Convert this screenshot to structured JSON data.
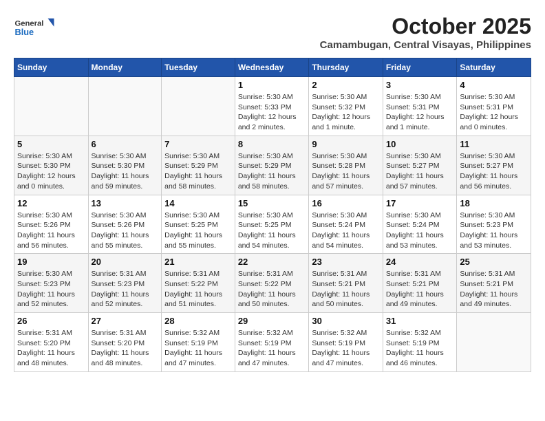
{
  "header": {
    "logo_line1": "General",
    "logo_line2": "Blue",
    "month_year": "October 2025",
    "location": "Camambugan, Central Visayas, Philippines"
  },
  "weekdays": [
    "Sunday",
    "Monday",
    "Tuesday",
    "Wednesday",
    "Thursday",
    "Friday",
    "Saturday"
  ],
  "weeks": [
    [
      {
        "day": "",
        "info": ""
      },
      {
        "day": "",
        "info": ""
      },
      {
        "day": "",
        "info": ""
      },
      {
        "day": "1",
        "info": "Sunrise: 5:30 AM\nSunset: 5:33 PM\nDaylight: 12 hours\nand 2 minutes."
      },
      {
        "day": "2",
        "info": "Sunrise: 5:30 AM\nSunset: 5:32 PM\nDaylight: 12 hours\nand 1 minute."
      },
      {
        "day": "3",
        "info": "Sunrise: 5:30 AM\nSunset: 5:31 PM\nDaylight: 12 hours\nand 1 minute."
      },
      {
        "day": "4",
        "info": "Sunrise: 5:30 AM\nSunset: 5:31 PM\nDaylight: 12 hours\nand 0 minutes."
      }
    ],
    [
      {
        "day": "5",
        "info": "Sunrise: 5:30 AM\nSunset: 5:30 PM\nDaylight: 12 hours\nand 0 minutes."
      },
      {
        "day": "6",
        "info": "Sunrise: 5:30 AM\nSunset: 5:30 PM\nDaylight: 11 hours\nand 59 minutes."
      },
      {
        "day": "7",
        "info": "Sunrise: 5:30 AM\nSunset: 5:29 PM\nDaylight: 11 hours\nand 58 minutes."
      },
      {
        "day": "8",
        "info": "Sunrise: 5:30 AM\nSunset: 5:29 PM\nDaylight: 11 hours\nand 58 minutes."
      },
      {
        "day": "9",
        "info": "Sunrise: 5:30 AM\nSunset: 5:28 PM\nDaylight: 11 hours\nand 57 minutes."
      },
      {
        "day": "10",
        "info": "Sunrise: 5:30 AM\nSunset: 5:27 PM\nDaylight: 11 hours\nand 57 minutes."
      },
      {
        "day": "11",
        "info": "Sunrise: 5:30 AM\nSunset: 5:27 PM\nDaylight: 11 hours\nand 56 minutes."
      }
    ],
    [
      {
        "day": "12",
        "info": "Sunrise: 5:30 AM\nSunset: 5:26 PM\nDaylight: 11 hours\nand 56 minutes."
      },
      {
        "day": "13",
        "info": "Sunrise: 5:30 AM\nSunset: 5:26 PM\nDaylight: 11 hours\nand 55 minutes."
      },
      {
        "day": "14",
        "info": "Sunrise: 5:30 AM\nSunset: 5:25 PM\nDaylight: 11 hours\nand 55 minutes."
      },
      {
        "day": "15",
        "info": "Sunrise: 5:30 AM\nSunset: 5:25 PM\nDaylight: 11 hours\nand 54 minutes."
      },
      {
        "day": "16",
        "info": "Sunrise: 5:30 AM\nSunset: 5:24 PM\nDaylight: 11 hours\nand 54 minutes."
      },
      {
        "day": "17",
        "info": "Sunrise: 5:30 AM\nSunset: 5:24 PM\nDaylight: 11 hours\nand 53 minutes."
      },
      {
        "day": "18",
        "info": "Sunrise: 5:30 AM\nSunset: 5:23 PM\nDaylight: 11 hours\nand 53 minutes."
      }
    ],
    [
      {
        "day": "19",
        "info": "Sunrise: 5:30 AM\nSunset: 5:23 PM\nDaylight: 11 hours\nand 52 minutes."
      },
      {
        "day": "20",
        "info": "Sunrise: 5:31 AM\nSunset: 5:23 PM\nDaylight: 11 hours\nand 52 minutes."
      },
      {
        "day": "21",
        "info": "Sunrise: 5:31 AM\nSunset: 5:22 PM\nDaylight: 11 hours\nand 51 minutes."
      },
      {
        "day": "22",
        "info": "Sunrise: 5:31 AM\nSunset: 5:22 PM\nDaylight: 11 hours\nand 50 minutes."
      },
      {
        "day": "23",
        "info": "Sunrise: 5:31 AM\nSunset: 5:21 PM\nDaylight: 11 hours\nand 50 minutes."
      },
      {
        "day": "24",
        "info": "Sunrise: 5:31 AM\nSunset: 5:21 PM\nDaylight: 11 hours\nand 49 minutes."
      },
      {
        "day": "25",
        "info": "Sunrise: 5:31 AM\nSunset: 5:21 PM\nDaylight: 11 hours\nand 49 minutes."
      }
    ],
    [
      {
        "day": "26",
        "info": "Sunrise: 5:31 AM\nSunset: 5:20 PM\nDaylight: 11 hours\nand 48 minutes."
      },
      {
        "day": "27",
        "info": "Sunrise: 5:31 AM\nSunset: 5:20 PM\nDaylight: 11 hours\nand 48 minutes."
      },
      {
        "day": "28",
        "info": "Sunrise: 5:32 AM\nSunset: 5:19 PM\nDaylight: 11 hours\nand 47 minutes."
      },
      {
        "day": "29",
        "info": "Sunrise: 5:32 AM\nSunset: 5:19 PM\nDaylight: 11 hours\nand 47 minutes."
      },
      {
        "day": "30",
        "info": "Sunrise: 5:32 AM\nSunset: 5:19 PM\nDaylight: 11 hours\nand 47 minutes."
      },
      {
        "day": "31",
        "info": "Sunrise: 5:32 AM\nSunset: 5:19 PM\nDaylight: 11 hours\nand 46 minutes."
      },
      {
        "day": "",
        "info": ""
      }
    ]
  ]
}
